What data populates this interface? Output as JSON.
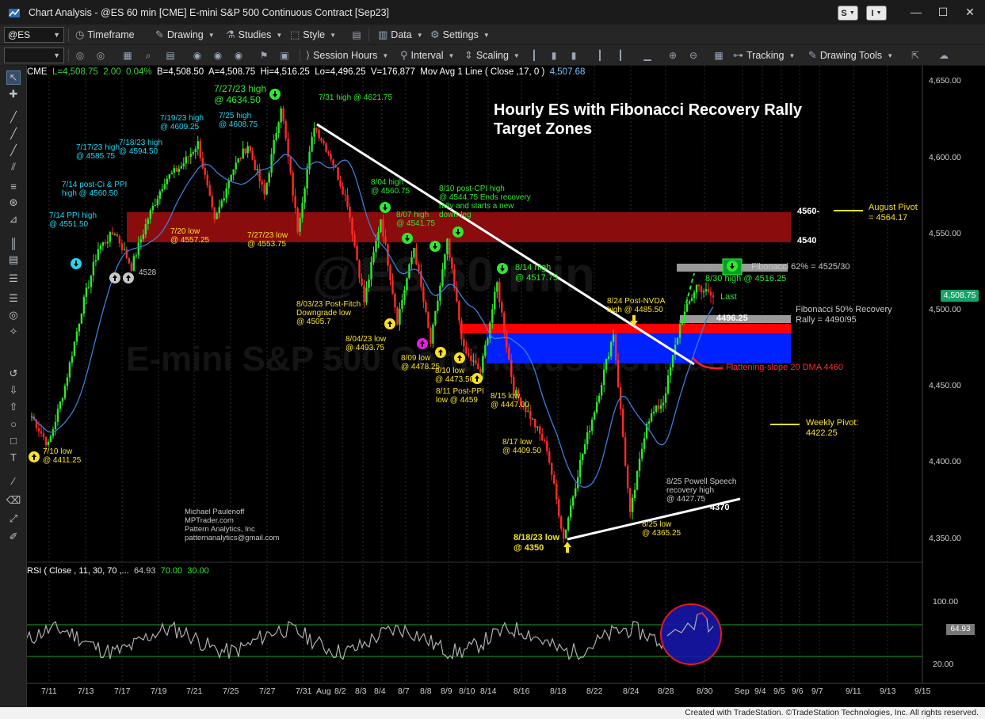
{
  "window": {
    "title": "Chart Analysis - @ES 60 min [CME] E-mini S&P 500 Continuous Contract [Sep23]",
    "s_button": "S",
    "i_button": "I"
  },
  "toolbar1": {
    "symbol": "@ES",
    "timeframe": "Timeframe",
    "drawing": "Drawing",
    "studies": "Studies",
    "style": "Style",
    "data": "Data",
    "settings": "Settings"
  },
  "toolbar2": {
    "session_hours": "Session Hours",
    "interval": "Interval",
    "scaling": "Scaling",
    "tracking": "Tracking",
    "drawing_tools": "Drawing Tools"
  },
  "info": {
    "exchange": "CME",
    "last": "L=4,508.75",
    "change": "2.00",
    "pct": "0.04%",
    "bid": "B=4,508.50",
    "ask": "A=4,508.75",
    "high": "Hi=4,516.25",
    "low": "Lo=4,496.25",
    "volume": "V=176,877",
    "ma_label": "Mov Avg 1 Line ( Close ,17, 0 )",
    "ma_value": "4,507.68"
  },
  "chart_title_line1": "Hourly ES with Fibonacci Recovery Rally",
  "chart_title_line2": "Target Zones",
  "watermark": "@ES 60 min",
  "watermark2": "E-mini S&P 500 Continuous Contract",
  "colors": {
    "up": "#2ee82e",
    "down": "#ff2a2a",
    "ma": "#3b7dd8",
    "resistance": "#8b0c0c",
    "red_band": "#ff0000",
    "blue_band": "#0022ff",
    "rsi_line": "#b0b0b0"
  },
  "annotations": {
    "a710": [
      "7/10 low",
      "@ 4411.25"
    ],
    "a714ppi": [
      "7/14 PPI high",
      "@ 4551.50"
    ],
    "a714ci": [
      "7/14 post-Ci & PPI",
      "high @ 4560.50"
    ],
    "a717": [
      "7/17/23 high",
      "@ 4585.75"
    ],
    "a718": [
      "7/18/23 high",
      "@ 4594.50"
    ],
    "a719": [
      "7/19/23 high",
      "@ 4609.25"
    ],
    "a725": [
      "7/25 high",
      "@ 4608.75"
    ],
    "a727": [
      "7/27/23 high",
      "@ 4634.50"
    ],
    "a731": "7/31 high @ 4621.75",
    "a720": [
      "7/20 low",
      "@ 4557.25"
    ],
    "a727low": [
      "7/27/23 low",
      "@ 4553.75"
    ],
    "a4528": "4528",
    "a804": [
      "8/04 high",
      "@ 4560.75"
    ],
    "a807": [
      "8/07 high",
      "@ 4541.75"
    ],
    "a810cpi": [
      "8/10 post-CPI high",
      "@ 4544.75 Ends recovery",
      "rally and starts a new",
      "down-leg"
    ],
    "a803": [
      "8/03/23 Post-Fitch",
      "Downgrade low",
      "@ 4505.7"
    ],
    "a804low": [
      "8/04/23 low",
      "@ 4493.75"
    ],
    "a809": [
      "8/09 low",
      "@ 4478.25"
    ],
    "a810low": [
      "8/10 low",
      "@ 4473.50"
    ],
    "a811": [
      "8/11 Post-PPI",
      "low @ 4459"
    ],
    "a814": [
      "8/14 high",
      "@ 4517.75"
    ],
    "a815": [
      "8/15 low",
      "@ 4447.00"
    ],
    "a817": [
      "8/17 low",
      "@ 4409.50"
    ],
    "a818": [
      "8/18/23 low",
      "@ 4350"
    ],
    "a824": [
      "8/24 Post-NVDA",
      "high @ 4485.50"
    ],
    "a825low": [
      "8/25 low",
      "@ 4365.25"
    ],
    "a825powell": [
      "8/25 Powell Speech",
      "recovery high",
      "@ 4427.75"
    ],
    "a4370": "4370",
    "a830": "8/30 high @ 4516.25",
    "last": "Last",
    "a4496": "4496.25",
    "fib62": "Fibonacci 62% = 4525/30",
    "fib50": [
      "Fibonacci 50% Recovery",
      "Rally = 4490/95"
    ],
    "dma": "Flattening-slope 20 DMA 4460",
    "aug_pivot": [
      "August Pivot",
      "= 4564.17"
    ],
    "weekly_pivot": [
      "Weekly Pivot:",
      "4422.25"
    ],
    "r4560": "4560-",
    "r4540": "4540",
    "author": [
      "Michael Paulenoff",
      "MPTrader.com",
      "Pattern Analytics, Inc",
      "patternanalytics@gmail.com"
    ]
  },
  "price_axis": [
    "4,650.00",
    "4,600.00",
    "4,550.00",
    "4,500.00",
    "4,450.00",
    "4,400.00",
    "4,350.00"
  ],
  "last_price_flag": "4,508.75",
  "rsi": {
    "label": "RSI ( Close , 11, 30, 70 ,...",
    "value": "64.93",
    "upper": "70.00",
    "lower": "30.00",
    "axis": [
      "100.00",
      "20.00"
    ]
  },
  "x_axis": [
    "7/11",
    "7/13",
    "7/17",
    "7/19",
    "7/21",
    "7/25",
    "7/27",
    "7/31",
    "Aug",
    "8/2",
    "8/3",
    "8/4",
    "8/7",
    "8/8",
    "8/9",
    "8/10",
    "8/14",
    "8/16",
    "8/18",
    "8/22",
    "8/24",
    "8/28",
    "8/30",
    "Sep",
    "9/4",
    "9/5",
    "9/6",
    "9/7",
    "9/11",
    "9/13",
    "9/15"
  ],
  "footer": "Created with TradeStation. ©TradeStation Technologies, Inc. All rights reserved.",
  "chart_data": {
    "type": "candlestick",
    "symbol": "@ES",
    "interval": "60 min",
    "ylim": [
      4335,
      4660
    ],
    "price_path": [
      [
        "7/10",
        4430
      ],
      [
        "7/10",
        4411
      ],
      [
        "7/11",
        4450
      ],
      [
        "7/12",
        4500
      ],
      [
        "7/13",
        4540
      ],
      [
        "7/14",
        4551
      ],
      [
        "7/14",
        4528
      ],
      [
        "7/17",
        4560
      ],
      [
        "7/17",
        4585
      ],
      [
        "7/18",
        4594
      ],
      [
        "7/19",
        4609
      ],
      [
        "7/20",
        4557
      ],
      [
        "7/24",
        4590
      ],
      [
        "7/25",
        4608
      ],
      [
        "7/26",
        4575
      ],
      [
        "7/27",
        4634
      ],
      [
        "7/27",
        4553
      ],
      [
        "7/31",
        4621
      ],
      [
        "8/1",
        4600
      ],
      [
        "8/2",
        4570
      ],
      [
        "8/3",
        4505
      ],
      [
        "8/4",
        4560
      ],
      [
        "8/4",
        4493
      ],
      [
        "8/7",
        4541
      ],
      [
        "8/9",
        4478
      ],
      [
        "8/10",
        4544
      ],
      [
        "8/10",
        4473
      ],
      [
        "8/11",
        4459
      ],
      [
        "8/14",
        4517
      ],
      [
        "8/15",
        4447
      ],
      [
        "8/16",
        4430
      ],
      [
        "8/17",
        4409
      ],
      [
        "8/18",
        4350
      ],
      [
        "8/21",
        4400
      ],
      [
        "8/22",
        4440
      ],
      [
        "8/24",
        4485
      ],
      [
        "8/25",
        4365
      ],
      [
        "8/25",
        4427
      ],
      [
        "8/28",
        4440
      ],
      [
        "8/29",
        4490
      ],
      [
        "8/30",
        4516
      ],
      [
        "8/31",
        4508
      ]
    ],
    "levels": {
      "resistance_zone": [
        4540,
        4560
      ],
      "red_band": [
        4482,
        4488
      ],
      "blue_band": [
        4462,
        4482
      ],
      "fib_62": [
        4525,
        4530
      ],
      "fib_50": [
        4490,
        4495
      ],
      "august_pivot": 4564.17,
      "weekly_pivot": 4422.25,
      "dma20": 4460
    },
    "rsi_range": [
      0,
      100
    ]
  }
}
